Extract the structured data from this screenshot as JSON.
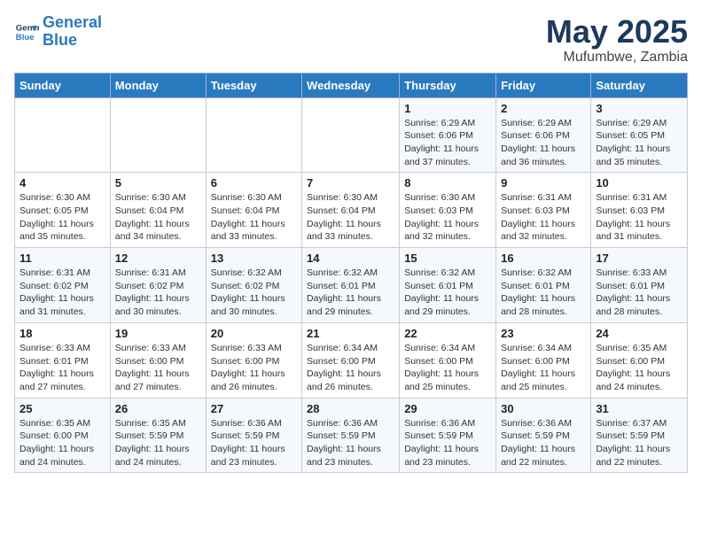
{
  "header": {
    "logo_line1": "General",
    "logo_line2": "Blue",
    "title": "May 2025",
    "subtitle": "Mufumbwe, Zambia"
  },
  "days_of_week": [
    "Sunday",
    "Monday",
    "Tuesday",
    "Wednesday",
    "Thursday",
    "Friday",
    "Saturday"
  ],
  "weeks": [
    [
      {
        "day": "",
        "info": ""
      },
      {
        "day": "",
        "info": ""
      },
      {
        "day": "",
        "info": ""
      },
      {
        "day": "",
        "info": ""
      },
      {
        "day": "1",
        "info": "Sunrise: 6:29 AM\nSunset: 6:06 PM\nDaylight: 11 hours\nand 37 minutes."
      },
      {
        "day": "2",
        "info": "Sunrise: 6:29 AM\nSunset: 6:06 PM\nDaylight: 11 hours\nand 36 minutes."
      },
      {
        "day": "3",
        "info": "Sunrise: 6:29 AM\nSunset: 6:05 PM\nDaylight: 11 hours\nand 35 minutes."
      }
    ],
    [
      {
        "day": "4",
        "info": "Sunrise: 6:30 AM\nSunset: 6:05 PM\nDaylight: 11 hours\nand 35 minutes."
      },
      {
        "day": "5",
        "info": "Sunrise: 6:30 AM\nSunset: 6:04 PM\nDaylight: 11 hours\nand 34 minutes."
      },
      {
        "day": "6",
        "info": "Sunrise: 6:30 AM\nSunset: 6:04 PM\nDaylight: 11 hours\nand 33 minutes."
      },
      {
        "day": "7",
        "info": "Sunrise: 6:30 AM\nSunset: 6:04 PM\nDaylight: 11 hours\nand 33 minutes."
      },
      {
        "day": "8",
        "info": "Sunrise: 6:30 AM\nSunset: 6:03 PM\nDaylight: 11 hours\nand 32 minutes."
      },
      {
        "day": "9",
        "info": "Sunrise: 6:31 AM\nSunset: 6:03 PM\nDaylight: 11 hours\nand 32 minutes."
      },
      {
        "day": "10",
        "info": "Sunrise: 6:31 AM\nSunset: 6:03 PM\nDaylight: 11 hours\nand 31 minutes."
      }
    ],
    [
      {
        "day": "11",
        "info": "Sunrise: 6:31 AM\nSunset: 6:02 PM\nDaylight: 11 hours\nand 31 minutes."
      },
      {
        "day": "12",
        "info": "Sunrise: 6:31 AM\nSunset: 6:02 PM\nDaylight: 11 hours\nand 30 minutes."
      },
      {
        "day": "13",
        "info": "Sunrise: 6:32 AM\nSunset: 6:02 PM\nDaylight: 11 hours\nand 30 minutes."
      },
      {
        "day": "14",
        "info": "Sunrise: 6:32 AM\nSunset: 6:01 PM\nDaylight: 11 hours\nand 29 minutes."
      },
      {
        "day": "15",
        "info": "Sunrise: 6:32 AM\nSunset: 6:01 PM\nDaylight: 11 hours\nand 29 minutes."
      },
      {
        "day": "16",
        "info": "Sunrise: 6:32 AM\nSunset: 6:01 PM\nDaylight: 11 hours\nand 28 minutes."
      },
      {
        "day": "17",
        "info": "Sunrise: 6:33 AM\nSunset: 6:01 PM\nDaylight: 11 hours\nand 28 minutes."
      }
    ],
    [
      {
        "day": "18",
        "info": "Sunrise: 6:33 AM\nSunset: 6:01 PM\nDaylight: 11 hours\nand 27 minutes."
      },
      {
        "day": "19",
        "info": "Sunrise: 6:33 AM\nSunset: 6:00 PM\nDaylight: 11 hours\nand 27 minutes."
      },
      {
        "day": "20",
        "info": "Sunrise: 6:33 AM\nSunset: 6:00 PM\nDaylight: 11 hours\nand 26 minutes."
      },
      {
        "day": "21",
        "info": "Sunrise: 6:34 AM\nSunset: 6:00 PM\nDaylight: 11 hours\nand 26 minutes."
      },
      {
        "day": "22",
        "info": "Sunrise: 6:34 AM\nSunset: 6:00 PM\nDaylight: 11 hours\nand 25 minutes."
      },
      {
        "day": "23",
        "info": "Sunrise: 6:34 AM\nSunset: 6:00 PM\nDaylight: 11 hours\nand 25 minutes."
      },
      {
        "day": "24",
        "info": "Sunrise: 6:35 AM\nSunset: 6:00 PM\nDaylight: 11 hours\nand 24 minutes."
      }
    ],
    [
      {
        "day": "25",
        "info": "Sunrise: 6:35 AM\nSunset: 6:00 PM\nDaylight: 11 hours\nand 24 minutes."
      },
      {
        "day": "26",
        "info": "Sunrise: 6:35 AM\nSunset: 5:59 PM\nDaylight: 11 hours\nand 24 minutes."
      },
      {
        "day": "27",
        "info": "Sunrise: 6:36 AM\nSunset: 5:59 PM\nDaylight: 11 hours\nand 23 minutes."
      },
      {
        "day": "28",
        "info": "Sunrise: 6:36 AM\nSunset: 5:59 PM\nDaylight: 11 hours\nand 23 minutes."
      },
      {
        "day": "29",
        "info": "Sunrise: 6:36 AM\nSunset: 5:59 PM\nDaylight: 11 hours\nand 23 minutes."
      },
      {
        "day": "30",
        "info": "Sunrise: 6:36 AM\nSunset: 5:59 PM\nDaylight: 11 hours\nand 22 minutes."
      },
      {
        "day": "31",
        "info": "Sunrise: 6:37 AM\nSunset: 5:59 PM\nDaylight: 11 hours\nand 22 minutes."
      }
    ]
  ]
}
